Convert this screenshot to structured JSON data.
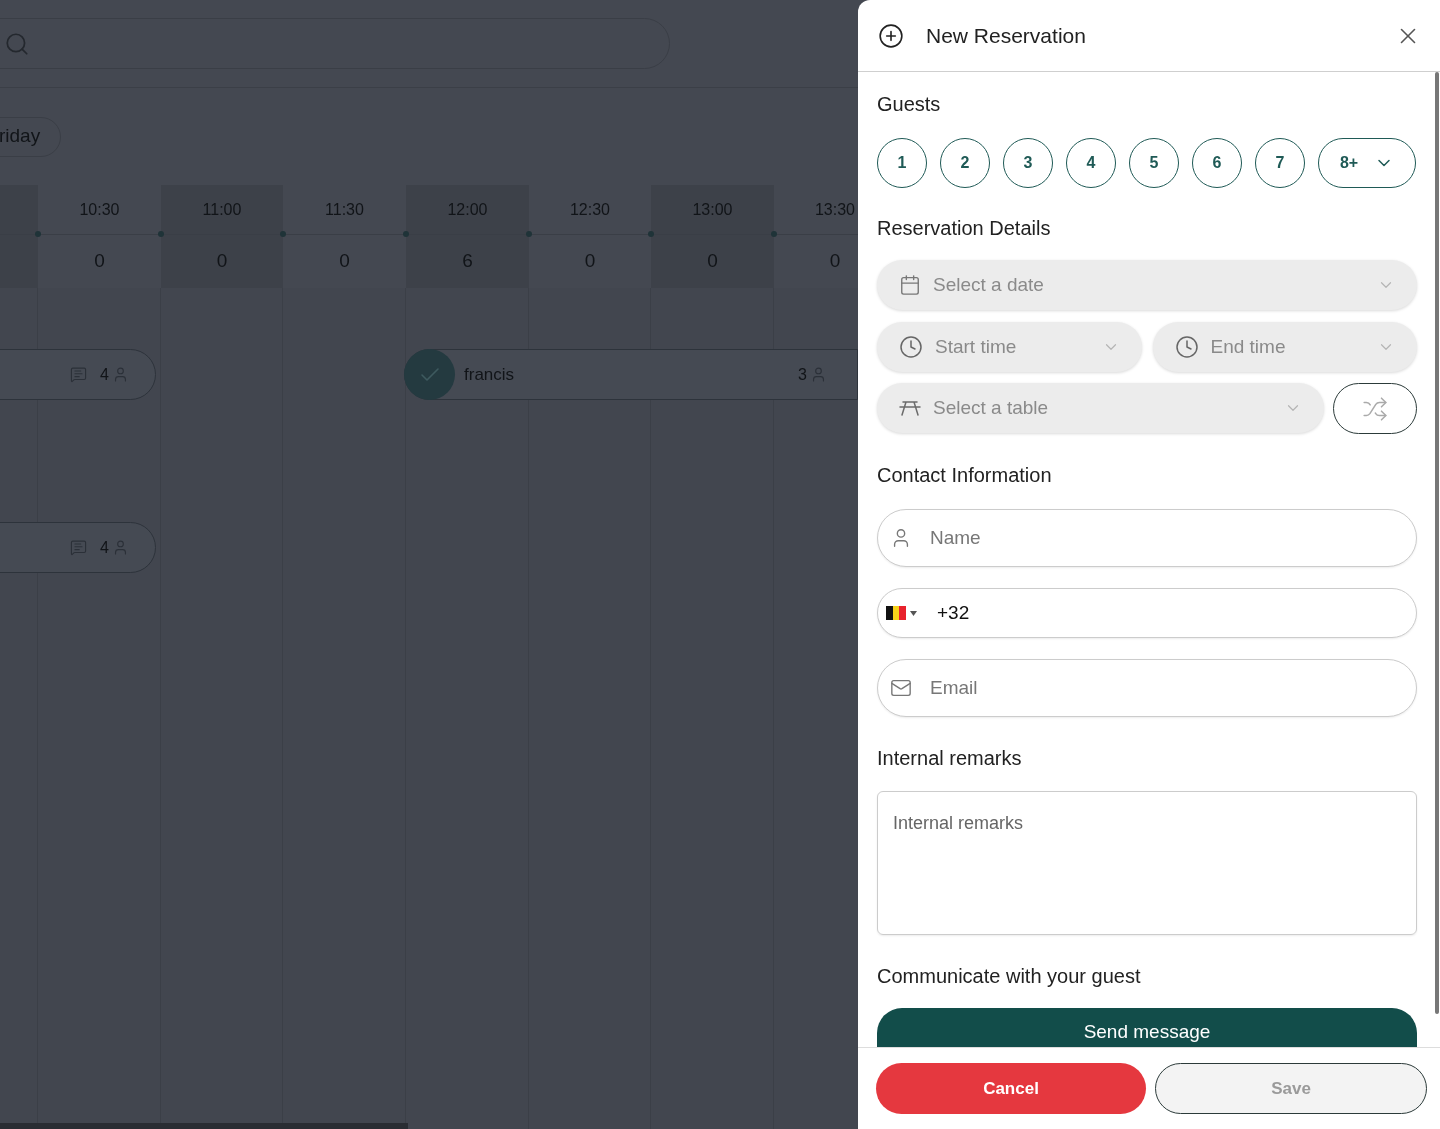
{
  "schedule": {
    "day_chip": "riday",
    "slots": [
      {
        "time": "10:30",
        "count": "0"
      },
      {
        "time": "11:00",
        "count": "0"
      },
      {
        "time": "11:30",
        "count": "0"
      },
      {
        "time": "12:00",
        "count": "6"
      },
      {
        "time": "12:30",
        "count": "0"
      },
      {
        "time": "13:00",
        "count": "0"
      },
      {
        "time": "13:30",
        "count": "0"
      }
    ],
    "reservations": [
      {
        "kind": "comment",
        "guests": "4"
      },
      {
        "kind": "checked",
        "name": "francis",
        "guests": "3"
      },
      {
        "kind": "comment",
        "guests": "4"
      }
    ]
  },
  "panel": {
    "title": "New Reservation",
    "guests": {
      "title": "Guests",
      "options": [
        {
          "label": "1",
          "selected": false
        },
        {
          "label": "2",
          "selected": false
        },
        {
          "label": "3",
          "selected": false
        },
        {
          "label": "4",
          "selected": false
        },
        {
          "label": "5",
          "selected": false
        },
        {
          "label": "6",
          "selected": false
        },
        {
          "label": "7",
          "selected": false
        }
      ],
      "more": {
        "label": "8+"
      }
    },
    "details": {
      "title": "Reservation Details",
      "date": {
        "placeholder": "Select a date"
      },
      "start_time": {
        "placeholder": "Start time"
      },
      "end_time": {
        "placeholder": "End time"
      },
      "table": {
        "placeholder": "Select a table"
      }
    },
    "contact": {
      "title": "Contact Information",
      "name": {
        "placeholder": "Name"
      },
      "phone": {
        "value": "+32"
      },
      "email": {
        "placeholder": "Email"
      }
    },
    "remarks": {
      "title": "Internal remarks",
      "placeholder": "Internal remarks"
    },
    "communicate": {
      "title": "Communicate with your guest",
      "button": "Send message"
    },
    "footer": {
      "cancel": "Cancel",
      "save": {
        "label": "Save",
        "disabled": true
      }
    }
  }
}
